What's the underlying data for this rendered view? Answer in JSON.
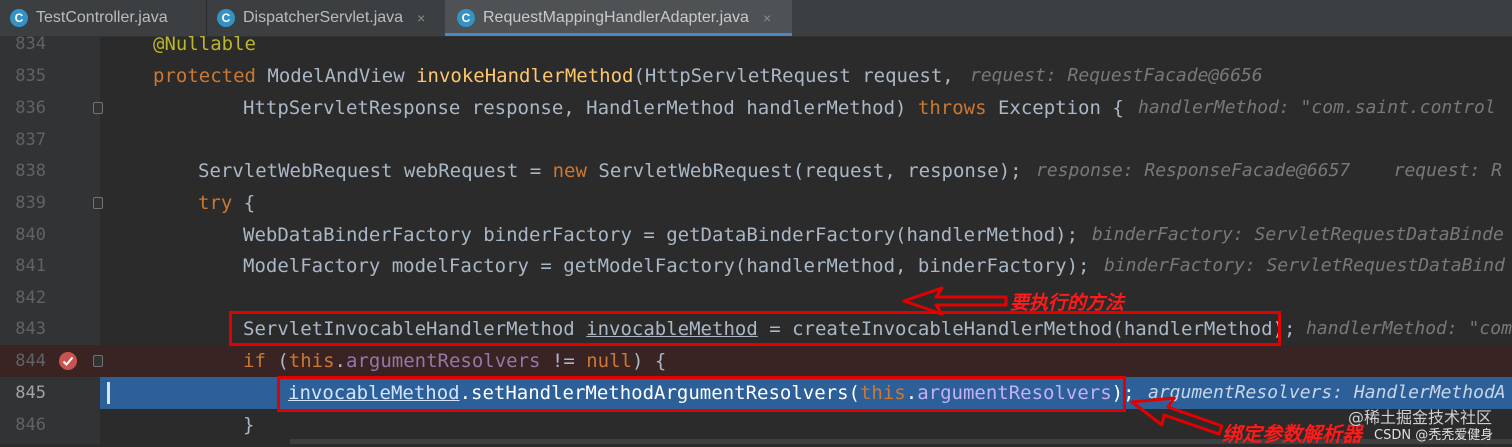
{
  "tabs": [
    {
      "label": "TestController.java",
      "icon": "java-class-icon",
      "active": false
    },
    {
      "label": "DispatcherServlet.java",
      "icon": "java-class-icon",
      "active": false
    },
    {
      "label": "RequestMappingHandlerAdapter.java",
      "icon": "java-class-icon",
      "active": true
    }
  ],
  "tab_icon_letter": "C",
  "tab_close": "×",
  "line_numbers": [
    "834",
    "835",
    "836",
    "837",
    "838",
    "839",
    "840",
    "841",
    "842",
    "843",
    "844",
    "845",
    "846"
  ],
  "code": {
    "l834": {
      "annotation": "@Nullable"
    },
    "l835": {
      "kw": "protected",
      "type": " ModelAndView ",
      "method": "invokeHandlerMethod",
      "params": "(HttpServletRequest request,",
      "hint": "request: RequestFacade@6656"
    },
    "l836": {
      "part1": "HttpServletResponse response, HandlerMethod handlerMethod) ",
      "kw": "throws",
      "part2": " Exception {",
      "hint": "handlerMethod: \"com.saint.control"
    },
    "l838": {
      "part1": "ServletWebRequest webRequest = ",
      "kw": "new",
      "part2": " ServletWebRequest(request, response);",
      "hint": "response: ResponseFacade@6657    request: R"
    },
    "l839": {
      "kw": "try",
      "part2": " {"
    },
    "l840": {
      "text": "WebDataBinderFactory binderFactory = getDataBinderFactory(handlerMethod);",
      "hint": "binderFactory: ServletRequestDataBinde"
    },
    "l841": {
      "text": "ModelFactory modelFactory = getModelFactory(handlerMethod, binderFactory);",
      "hint": "binderFactory: ServletRequestDataBind"
    },
    "l843": {
      "part1": "ServletInvocableHandlerMethod ",
      "var": "invocableMethod",
      "part2": " = createInvocableHandlerMethod(handlerMethod);",
      "hint": "handlerMethod: \"com"
    },
    "l844": {
      "kw1": "if",
      "part1": " (",
      "kw2": "this",
      "part2": ".",
      "field": "argumentResolvers",
      "part3": " != ",
      "kw3": "null",
      "part4": ") {"
    },
    "l845": {
      "var": "invocableMethod",
      "part1": ".setHandlerMethodArgumentResolvers(",
      "kw": "this",
      "part2": ".",
      "field": "argumentResolvers",
      "part3": ");",
      "hint": "argumentResolvers: HandlerMethodA"
    },
    "l846": {
      "text": "}"
    }
  },
  "annotations": {
    "method_note": "要执行的方法",
    "resolver_note": "绑定参数解析器"
  },
  "watermark": {
    "line1": "@稀土掘金技术社区",
    "line2": "CSDN @秃秃爱健身"
  },
  "colors": {
    "editor_bg": "#2b2b2b",
    "gutter_bg": "#313335",
    "keyword": "#cc7832",
    "method_decl": "#ffc66d",
    "field": "#9876aa",
    "annotation": "#bbb529",
    "text": "#a9b7c6",
    "breakpoint_line": "#3a2323",
    "execution_line": "#2d6099",
    "markup_red": "#e30000"
  }
}
